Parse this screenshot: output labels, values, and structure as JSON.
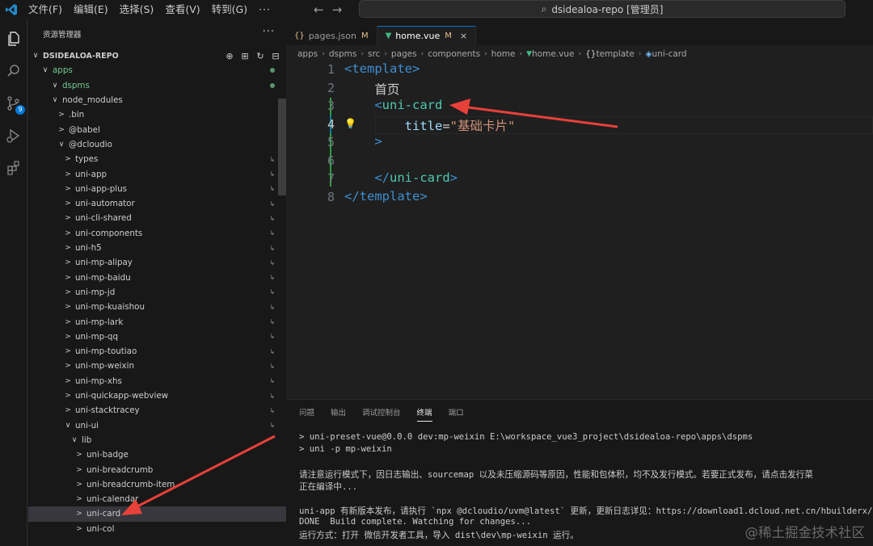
{
  "titlebar": {
    "menu": [
      "文件(F)",
      "编辑(E)",
      "选择(S)",
      "查看(V)",
      "转到(G)"
    ],
    "more": "···",
    "command_center": "dsidealoa-repo [管理员]"
  },
  "activity": {
    "source_control_badge": "9"
  },
  "explorer": {
    "title": "资源管理器",
    "more": "···",
    "rows": [
      {
        "label": "DSIDEALOA-REPO",
        "indent": 4,
        "chev": "∨",
        "root": true
      },
      {
        "label": "apps",
        "indent": 16,
        "chev": "∨",
        "green": true,
        "dot": true
      },
      {
        "label": "dspms",
        "indent": 28,
        "chev": "∨",
        "green": true,
        "dot": true
      },
      {
        "label": "node_modules",
        "indent": 28,
        "chev": "∨"
      },
      {
        "label": ".bin",
        "indent": 36,
        "chev": ">"
      },
      {
        "label": "@babel",
        "indent": 36,
        "chev": ">"
      },
      {
        "label": "@dcloudio",
        "indent": 36,
        "chev": "∨"
      },
      {
        "label": "types",
        "indent": 44,
        "chev": ">",
        "link": true
      },
      {
        "label": "uni-app",
        "indent": 44,
        "chev": ">",
        "link": true
      },
      {
        "label": "uni-app-plus",
        "indent": 44,
        "chev": ">",
        "link": true
      },
      {
        "label": "uni-automator",
        "indent": 44,
        "chev": ">",
        "link": true
      },
      {
        "label": "uni-cli-shared",
        "indent": 44,
        "chev": ">",
        "link": true
      },
      {
        "label": "uni-components",
        "indent": 44,
        "chev": ">",
        "link": true
      },
      {
        "label": "uni-h5",
        "indent": 44,
        "chev": ">",
        "link": true
      },
      {
        "label": "uni-mp-alipay",
        "indent": 44,
        "chev": ">",
        "link": true
      },
      {
        "label": "uni-mp-baidu",
        "indent": 44,
        "chev": ">",
        "link": true
      },
      {
        "label": "uni-mp-jd",
        "indent": 44,
        "chev": ">",
        "link": true
      },
      {
        "label": "uni-mp-kuaishou",
        "indent": 44,
        "chev": ">",
        "link": true
      },
      {
        "label": "uni-mp-lark",
        "indent": 44,
        "chev": ">",
        "link": true
      },
      {
        "label": "uni-mp-qq",
        "indent": 44,
        "chev": ">",
        "link": true
      },
      {
        "label": "uni-mp-toutiao",
        "indent": 44,
        "chev": ">",
        "link": true
      },
      {
        "label": "uni-mp-weixin",
        "indent": 44,
        "chev": ">",
        "link": true
      },
      {
        "label": "uni-mp-xhs",
        "indent": 44,
        "chev": ">",
        "link": true
      },
      {
        "label": "uni-quickapp-webview",
        "indent": 44,
        "chev": ">",
        "link": true
      },
      {
        "label": "uni-stacktracey",
        "indent": 44,
        "chev": ">",
        "link": true
      },
      {
        "label": "uni-ui",
        "indent": 44,
        "chev": "∨",
        "link": true
      },
      {
        "label": "lib",
        "indent": 52,
        "chev": "∨"
      },
      {
        "label": "uni-badge",
        "indent": 58,
        "chev": ">"
      },
      {
        "label": "uni-breadcrumb",
        "indent": 58,
        "chev": ">"
      },
      {
        "label": "uni-breadcrumb-item",
        "indent": 58,
        "chev": ">"
      },
      {
        "label": "uni-calendar",
        "indent": 58,
        "chev": ">"
      },
      {
        "label": "uni-card",
        "indent": 58,
        "chev": ">",
        "selected": true
      },
      {
        "label": "uni-col",
        "indent": 58,
        "chev": ">"
      }
    ]
  },
  "tabs": [
    {
      "label": "pages.json",
      "icon": "{}",
      "modified": "M",
      "active": false
    },
    {
      "label": "home.vue",
      "icon": "▼",
      "modified": "M",
      "active": true,
      "close": "×"
    }
  ],
  "breadcrumb": [
    "apps",
    "dspms",
    "src",
    "pages",
    "components",
    "home",
    "home.vue",
    "template",
    "uni-card"
  ],
  "code": {
    "line_numbers": [
      "1",
      "2",
      "3",
      "4",
      "5",
      "6",
      "7",
      "8"
    ],
    "current_line": "4",
    "lines": [
      {
        "indent": "",
        "parts": [
          {
            "t": "<",
            "c": "tag"
          },
          {
            "t": "template",
            "c": "tag"
          },
          {
            "t": ">",
            "c": "tag"
          }
        ]
      },
      {
        "indent": "    ",
        "parts": [
          {
            "t": "首页",
            "c": "txt"
          }
        ]
      },
      {
        "indent": "    ",
        "parts": [
          {
            "t": "<",
            "c": "tag"
          },
          {
            "t": "uni-card",
            "c": "tagname"
          }
        ]
      },
      {
        "indent": "        ",
        "parts": [
          {
            "t": "title",
            "c": "attr"
          },
          {
            "t": "=",
            "c": "txt"
          },
          {
            "t": "\"基础卡片\"",
            "c": "str"
          }
        ]
      },
      {
        "indent": "    ",
        "parts": [
          {
            "t": ">",
            "c": "tag"
          }
        ]
      },
      {
        "indent": "",
        "parts": []
      },
      {
        "indent": "    ",
        "parts": [
          {
            "t": "</",
            "c": "tag"
          },
          {
            "t": "uni-card",
            "c": "tagname"
          },
          {
            "t": ">",
            "c": "tag"
          }
        ]
      },
      {
        "indent": "",
        "parts": [
          {
            "t": "</",
            "c": "tag"
          },
          {
            "t": "template",
            "c": "tag"
          },
          {
            "t": ">",
            "c": "tag"
          }
        ]
      }
    ]
  },
  "panel": {
    "tabs": [
      "问题",
      "输出",
      "调试控制台",
      "终端",
      "端口"
    ],
    "active_tab": "终端",
    "terminal": [
      "> uni-preset-vue@0.0.0 dev:mp-weixin E:\\workspace_vue3_project\\dsidealoa-repo\\apps\\dspms",
      "> uni -p mp-weixin",
      "",
      "请注意运行模式下，因日志输出、sourcemap 以及未压缩源码等原因，性能和包体积，均不及发行模式。若要正式发布，请点击发行菜",
      "正在编译中...",
      "",
      "uni-app 有新版本发布，请执行 `npx @dcloudio/uvm@latest` 更新，更新日志详见：https://download1.dcloud.net.cn/hbuilderx/",
      "DONE  Build complete. Watching for changes...",
      "运行方式：打开 微信开发者工具，导入 dist\\dev\\mp-weixin 运行。"
    ]
  },
  "watermark": "@稀土掘金技术社区",
  "colors": {
    "accent": "#0078d4",
    "arrow": "#e8413a",
    "git_added": "#73c991"
  }
}
